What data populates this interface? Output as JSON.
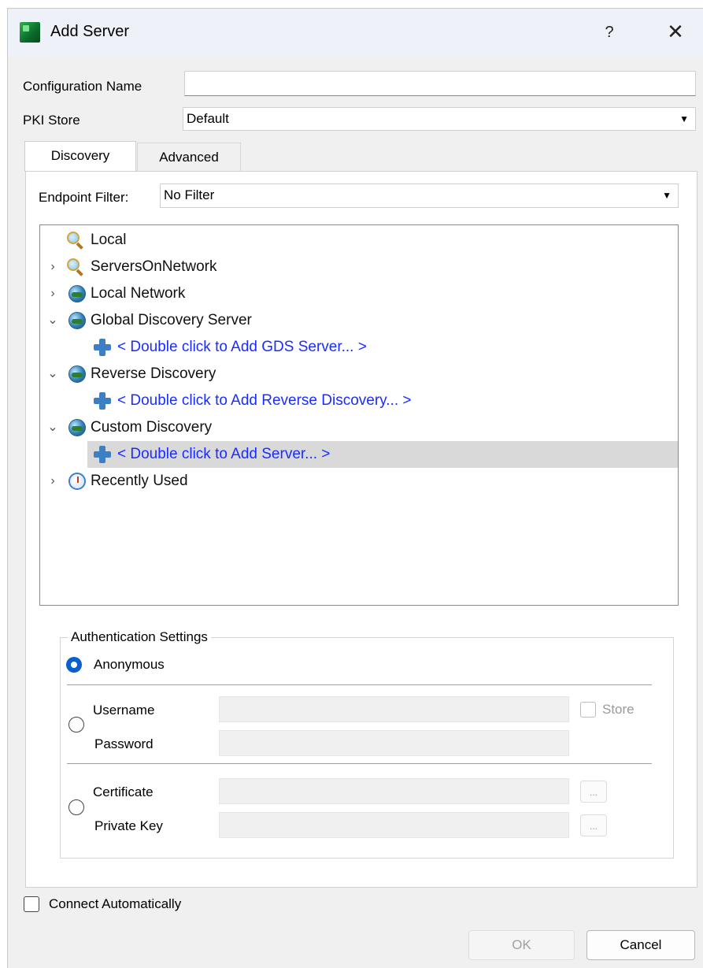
{
  "window": {
    "title": "Add Server",
    "help_glyph": "?",
    "close_glyph": "✕"
  },
  "form": {
    "config_name_label": "Configuration Name",
    "config_name_value": "",
    "pki_store_label": "PKI Store",
    "pki_store_value": "Default"
  },
  "tabs": [
    {
      "label": "Discovery",
      "active": true
    },
    {
      "label": "Advanced",
      "active": false
    }
  ],
  "discovery": {
    "endpoint_filter_label": "Endpoint Filter:",
    "endpoint_filter_value": "No Filter",
    "tree": [
      {
        "label": "Local",
        "icon": "magnifier-icon",
        "expander": ""
      },
      {
        "label": "ServersOnNetwork",
        "icon": "magnifier-icon",
        "expander": ">"
      },
      {
        "label": "Local Network",
        "icon": "globe-icon",
        "expander": ">"
      },
      {
        "label": "Global Discovery Server",
        "icon": "globe-icon",
        "expander": "v"
      },
      {
        "label": "< Double click to Add GDS Server... >",
        "icon": "plus-icon",
        "expander": "",
        "child": true
      },
      {
        "label": "Reverse Discovery",
        "icon": "globe-icon",
        "expander": "v"
      },
      {
        "label": "< Double click to Add Reverse Discovery... >",
        "icon": "plus-icon",
        "expander": "",
        "child": true
      },
      {
        "label": "Custom Discovery",
        "icon": "globe-icon",
        "expander": "v"
      },
      {
        "label": "< Double click to Add Server... >",
        "icon": "plus-icon",
        "expander": "",
        "child": true,
        "selected": true
      },
      {
        "label": "Recently Used",
        "icon": "clock-icon",
        "expander": ">"
      }
    ]
  },
  "auth": {
    "group_title": "Authentication Settings",
    "anonymous_label": "Anonymous",
    "username_label": "Username",
    "password_label": "Password",
    "store_label": "Store",
    "certificate_label": "Certificate",
    "private_key_label": "Private Key",
    "browse_glyph": "..."
  },
  "footer": {
    "connect_auto_label": "Connect Automatically",
    "ok_label": "OK",
    "cancel_label": "Cancel"
  },
  "colors": {
    "link": "#1a2cff",
    "selection": "#d9d9d9",
    "radio_checked": "#0a5fcf"
  }
}
